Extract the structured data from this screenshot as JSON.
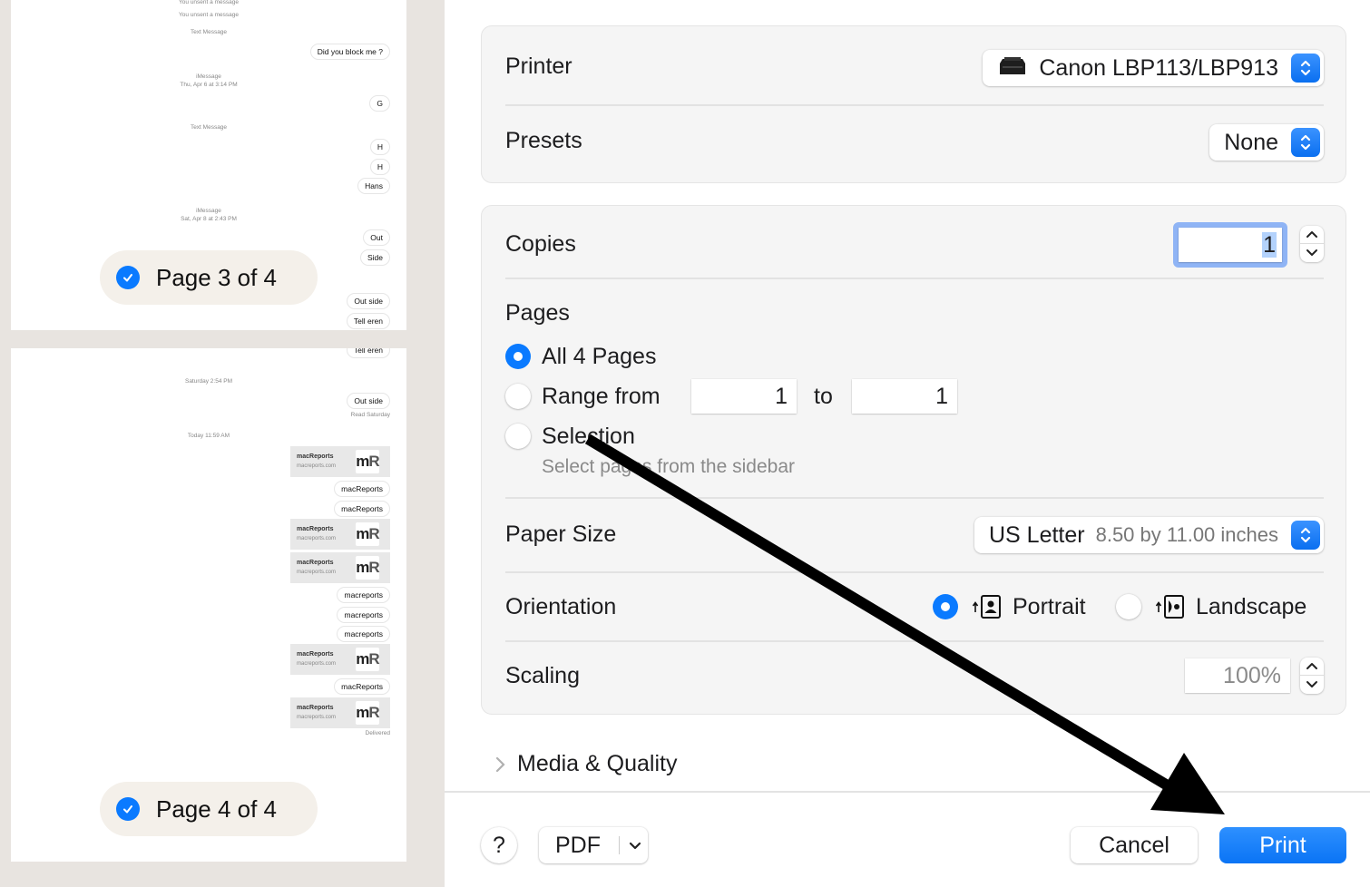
{
  "sidebar": {
    "page3": {
      "unsent_1": "You unsent a message",
      "unsent_2": "You unsent a message",
      "service_1": "Text Message",
      "msg_block": "Did you block me ?",
      "service_2": "iMessage",
      "time_1": "Thu, Apr 6 at 3:14 PM",
      "msg_g": "G",
      "service_3": "Text Message",
      "msg_h1": "H",
      "msg_h2": "H",
      "msg_hans": "Hans",
      "service_4": "iMessage",
      "time_2": "Sat, Apr 8 at 2:43 PM",
      "msg_out": "Out",
      "msg_side": "Side",
      "msg_outside": "Out side",
      "msg_cut": "Tell eren",
      "label": "Page 3 of 4",
      "selected": true
    },
    "page4": {
      "msg_cut": "Tell eren",
      "time_1": "Saturday 2:54 PM",
      "msg_outside": "Out side",
      "read_status": "Read Saturday",
      "time_2": "Today 11:59 AM",
      "link_title": "macReports",
      "link_url": "macreports.com",
      "logo_m": "m",
      "logo_r": "R",
      "msg_macreports_1": "macReports",
      "msg_macreports_2": "macReports",
      "msg_lower_1": "macreports",
      "msg_lower_2": "macreports",
      "msg_lower_3": "macreports",
      "msg_macreports_3": "macReports",
      "delivered": "Delivered",
      "label": "Page 4 of 4",
      "selected": true
    }
  },
  "dialog": {
    "printer": {
      "label": "Printer",
      "value": "Canon LBP113/LBP913",
      "icon": "printer-icon"
    },
    "presets": {
      "label": "Presets",
      "value": "None"
    },
    "copies": {
      "label": "Copies",
      "value": "1"
    },
    "pages": {
      "label": "Pages",
      "all_label": "All 4 Pages",
      "range_label": "Range from",
      "range_from": "1",
      "range_to_label": "to",
      "range_to": "1",
      "selection_label": "Selection",
      "selection_hint": "Select pages from the sidebar",
      "selected": "all"
    },
    "paper_size": {
      "label": "Paper Size",
      "value": "US Letter",
      "detail": "8.50 by 11.00 inches"
    },
    "orientation": {
      "label": "Orientation",
      "portrait": "Portrait",
      "landscape": "Landscape",
      "selected": "portrait"
    },
    "scaling": {
      "label": "Scaling",
      "value": "100%"
    },
    "media_quality": {
      "label": "Media & Quality"
    },
    "footer": {
      "help": "?",
      "pdf": "PDF",
      "cancel": "Cancel",
      "print": "Print"
    },
    "accent_color": "#0a7aff"
  },
  "annotation": {
    "type": "arrow",
    "color": "#000000",
    "points_from": "selection-option",
    "points_to": "print-button"
  }
}
